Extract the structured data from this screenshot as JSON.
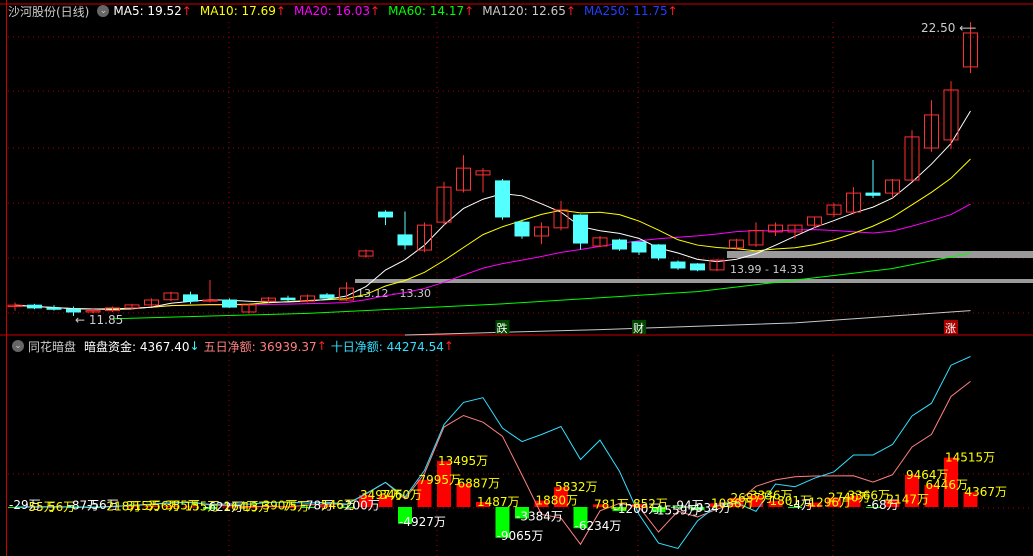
{
  "header": {
    "title": "沙河股份(日线)",
    "ma": [
      {
        "label": "MA5: 19.52",
        "color": "#ffffff"
      },
      {
        "label": "MA10: 17.69",
        "color": "#ffff00"
      },
      {
        "label": "MA20: 16.03",
        "color": "#ff00ff"
      },
      {
        "label": "MA60: 14.17",
        "color": "#00ff00"
      },
      {
        "label": "MA120: 12.65",
        "color": "#c8c8c8"
      },
      {
        "label": "MA250: 11.75",
        "color": "#2040ff"
      }
    ],
    "arrow": "↑"
  },
  "indicator": {
    "name": "同花暗盘",
    "fund_label": "暗盘资金: 4367.40",
    "fund_arrow": "↓",
    "five_label": "五日净额: 36939.37",
    "five_arrow": "↑",
    "ten_label": "十日净额: 44274.54",
    "ten_arrow": "↑"
  },
  "annotations": {
    "high": "22.50",
    "low": "11.85",
    "zone1": "13.12 - 13.30",
    "zone2": "13.99 - 14.33",
    "marks": [
      {
        "text": "跌",
        "i": 25
      },
      {
        "text": "财",
        "i": 32
      },
      {
        "text": "涨",
        "i": 48
      }
    ]
  },
  "colors": {
    "up": "#ff3030",
    "down": "#54ffff",
    "ma5": "#ffffff",
    "ma10": "#ffff00",
    "ma20": "#ff00ff",
    "ma60": "#00ff00",
    "ma120": "#c8c8c8",
    "five": "#ff8080",
    "ten": "#30e0ff"
  },
  "chart_data": {
    "type": "candlestick",
    "price_range": [
      11.5,
      23.0
    ],
    "candles": [
      [
        12.2,
        12.35,
        12.05,
        12.25
      ],
      [
        12.25,
        12.3,
        12.1,
        12.15
      ],
      [
        12.15,
        12.25,
        12.05,
        12.1
      ],
      [
        12.1,
        12.2,
        11.85,
        12.0
      ],
      [
        12.0,
        12.15,
        11.95,
        12.05
      ],
      [
        12.05,
        12.2,
        12.0,
        12.15
      ],
      [
        12.15,
        12.3,
        12.1,
        12.26
      ],
      [
        12.26,
        12.5,
        12.2,
        12.44
      ],
      [
        12.45,
        12.75,
        12.4,
        12.7
      ],
      [
        12.63,
        12.75,
        12.3,
        12.4
      ],
      [
        12.4,
        13.18,
        12.35,
        12.44
      ],
      [
        12.44,
        12.5,
        12.15,
        12.18
      ],
      [
        12.0,
        12.3,
        11.95,
        12.26
      ],
      [
        12.4,
        12.55,
        12.35,
        12.51
      ],
      [
        12.51,
        12.6,
        12.4,
        12.45
      ],
      [
        12.4,
        12.65,
        12.35,
        12.59
      ],
      [
        12.63,
        12.7,
        12.5,
        12.51
      ],
      [
        12.44,
        13.1,
        12.4,
        12.88
      ],
      [
        14.06,
        14.3,
        14.0,
        14.25
      ],
      [
        15.68,
        15.75,
        15.2,
        15.5
      ],
      [
        14.84,
        15.7,
        14.3,
        14.47
      ],
      [
        14.28,
        15.3,
        14.2,
        15.2
      ],
      [
        15.31,
        16.8,
        15.2,
        16.6
      ],
      [
        16.49,
        17.78,
        16.4,
        17.3
      ],
      [
        17.05,
        17.3,
        16.4,
        17.2
      ],
      [
        16.83,
        16.9,
        15.4,
        15.5
      ],
      [
        15.31,
        15.4,
        14.7,
        14.8
      ],
      [
        14.8,
        15.3,
        14.5,
        15.13
      ],
      [
        15.1,
        16.1,
        15.0,
        15.76
      ],
      [
        15.57,
        15.6,
        14.3,
        14.54
      ],
      [
        14.43,
        14.8,
        14.4,
        14.73
      ],
      [
        14.65,
        14.7,
        14.25,
        14.32
      ],
      [
        14.58,
        14.6,
        14.1,
        14.21
      ],
      [
        14.47,
        14.5,
        13.9,
        13.99
      ],
      [
        13.84,
        13.9,
        13.55,
        13.62
      ],
      [
        13.77,
        13.8,
        13.5,
        13.55
      ],
      [
        13.55,
        13.95,
        13.5,
        13.91
      ],
      [
        14.36,
        14.7,
        14.3,
        14.65
      ],
      [
        14.47,
        15.3,
        14.4,
        15.0
      ],
      [
        14.95,
        15.3,
        14.8,
        15.2
      ],
      [
        14.95,
        15.2,
        14.7,
        15.2
      ],
      [
        15.2,
        15.5,
        15.1,
        15.5
      ],
      [
        15.6,
        16.0,
        15.5,
        15.94
      ],
      [
        15.68,
        16.6,
        15.6,
        16.38
      ],
      [
        16.38,
        17.6,
        16.2,
        16.3
      ],
      [
        16.38,
        16.9,
        16.2,
        16.86
      ],
      [
        16.86,
        18.7,
        16.8,
        18.45
      ],
      [
        18.04,
        19.8,
        17.9,
        19.26
      ],
      [
        18.34,
        20.5,
        18.0,
        20.18
      ],
      [
        21.03,
        22.68,
        20.8,
        22.28
      ]
    ],
    "ma60": [
      [
        5,
        11.75
      ],
      [
        15,
        11.95
      ],
      [
        25,
        12.3
      ],
      [
        35,
        12.75
      ],
      [
        45,
        13.6
      ],
      [
        49,
        14.17
      ]
    ],
    "ma120": [
      [
        20,
        11.75
      ],
      [
        30,
        11.95
      ],
      [
        40,
        12.2
      ],
      [
        49,
        12.65
      ]
    ],
    "net_flow_wan": [
      -29,
      55,
      56,
      -87,
      -56,
      218,
      315,
      356,
      385,
      155,
      -622,
      164,
      13,
      390,
      75,
      -78,
      546,
      -200,
      3497,
      3460,
      -4927,
      7995,
      13495,
      6887,
      1487,
      -9065,
      -3384,
      1880,
      5832,
      -6234,
      781,
      -1200,
      852,
      -1559,
      -94,
      -934,
      1086,
      2687,
      3336,
      1801,
      -4,
      1296,
      2740,
      3366,
      -68,
      2147,
      9464,
      6446,
      14515,
      4367
    ]
  }
}
